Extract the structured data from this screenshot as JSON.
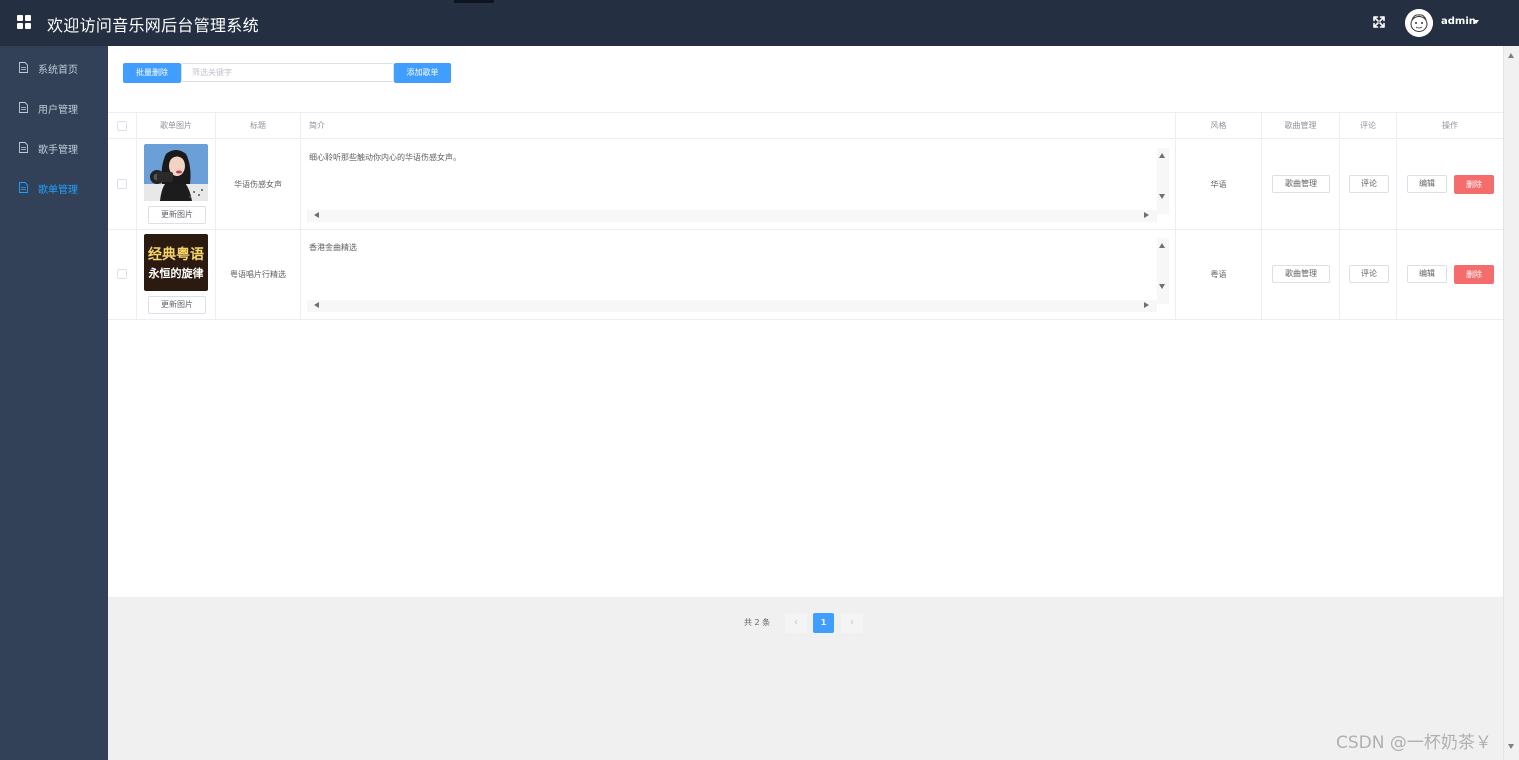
{
  "header": {
    "title": "欢迎访问音乐网后台管理系统",
    "username": "admin"
  },
  "sidebar": {
    "items": [
      {
        "label": "系统首页",
        "active": false
      },
      {
        "label": "用户管理",
        "active": false
      },
      {
        "label": "歌手管理",
        "active": false
      },
      {
        "label": "歌单管理",
        "active": true
      }
    ]
  },
  "toolbar": {
    "batch_delete_label": "批量删除",
    "search_placeholder": "筛选关键字",
    "add_label": "添加歌单"
  },
  "table": {
    "columns": [
      "歌单图片",
      "标题",
      "简介",
      "风格",
      "歌曲管理",
      "评论",
      "操作"
    ],
    "rows": [
      {
        "update_image_label": "更新图片",
        "title": "华语伤感女声",
        "intro": "细心聆听那些触动你内心的华语伤感女声。",
        "style": "华语",
        "song_manage_label": "歌曲管理",
        "comment_label": "评论",
        "edit_label": "编辑",
        "delete_label": "删除",
        "cover": {
          "logo_text": []
        }
      },
      {
        "update_image_label": "更新图片",
        "title": "粤语唱片行精选",
        "intro": "香港金曲精选",
        "style": "粤语",
        "song_manage_label": "歌曲管理",
        "comment_label": "评论",
        "edit_label": "编辑",
        "delete_label": "删除",
        "cover": {
          "logo_text": [
            "经典粤语",
            "永恒的旋律"
          ]
        }
      }
    ]
  },
  "pagination": {
    "total_label": "共 2 条",
    "prev": "‹",
    "current_page": "1",
    "next": "›"
  },
  "watermark": "CSDN @一杯奶茶￥",
  "colors": {
    "header_bg": "#242f42",
    "sidebar_bg": "#324157",
    "sidebar_active": "#20a0ff",
    "primary": "#409eff",
    "danger": "#f56c6c"
  },
  "icons": {
    "menu": "grid-icon",
    "fullscreen": "fullscreen-icon",
    "sidebar_item": "document-icon",
    "user_menu": "caret-down-icon"
  }
}
